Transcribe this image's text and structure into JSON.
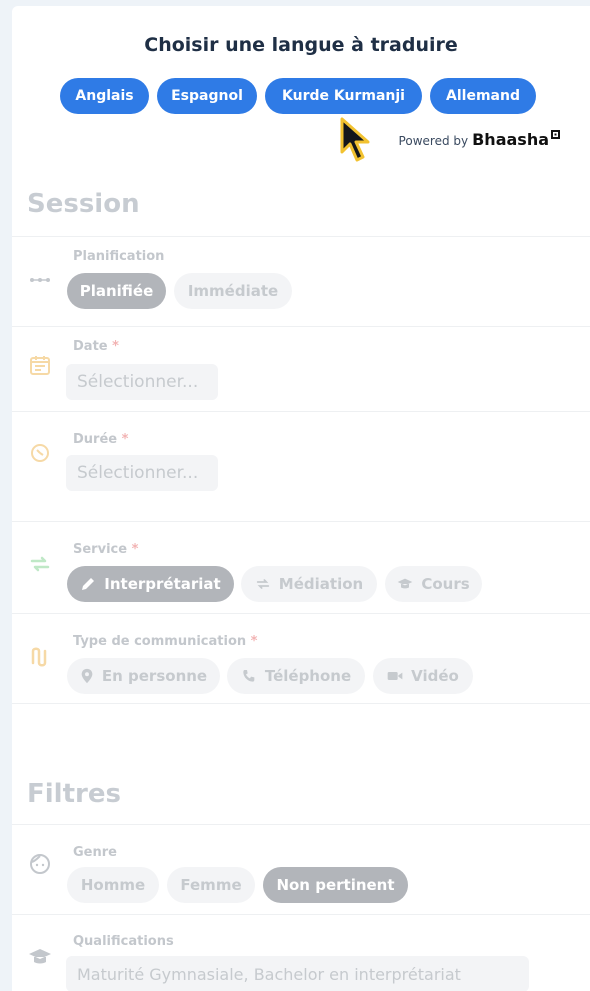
{
  "language": {
    "title": "Choisir une langue à traduire",
    "options": [
      "Anglais",
      "Espagnol",
      "Kurde Kurmanji",
      "Allemand"
    ],
    "powered_prefix": "Powered by",
    "powered_brand": "Bhaasha",
    "accent_color": "#2f7be6"
  },
  "session": {
    "title": "Session",
    "planification": {
      "label": "Planification",
      "options": [
        "Planifiée",
        "Immédiate"
      ],
      "selected": "Planifiée",
      "icon": "timeline-dots-icon"
    },
    "date": {
      "label": "Date",
      "required_mark": "*",
      "placeholder": "Sélectionner...",
      "icon": "calendar-icon"
    },
    "duree": {
      "label": "Durée",
      "required_mark": "*",
      "placeholder": "Sélectionner...",
      "icon": "timer-icon"
    },
    "service": {
      "label": "Service",
      "required_mark": "*",
      "options": [
        "Interprétariat",
        "Médiation",
        "Cours"
      ],
      "selected": "Interprétariat",
      "icon": "swap-arrows-icon"
    },
    "communication": {
      "label": "Type de communication",
      "required_mark": "*",
      "options": [
        "En personne",
        "Téléphone",
        "Vidéo"
      ],
      "icon": "route-icon"
    }
  },
  "filtres": {
    "title": "Filtres",
    "genre": {
      "label": "Genre",
      "options": [
        "Homme",
        "Femme",
        "Non pertinent"
      ],
      "selected": "Non pertinent",
      "icon": "face-icon"
    },
    "qualifications": {
      "label": "Qualifications",
      "value": "Maturité Gymnasiale, Bachelor en interprétariat",
      "icon": "graduation-cap-icon"
    }
  }
}
